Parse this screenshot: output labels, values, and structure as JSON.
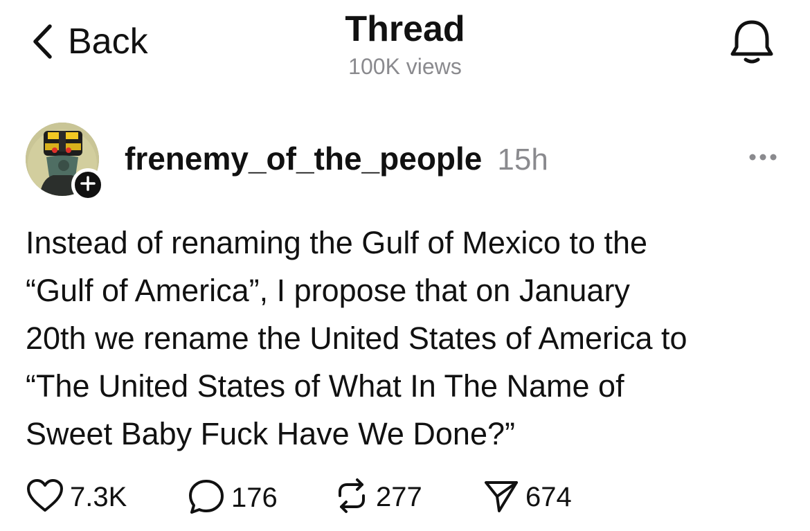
{
  "header": {
    "back_label": "Back",
    "title": "Thread",
    "views": "100K views"
  },
  "post": {
    "username": "frenemy_of_the_people",
    "time": "15h",
    "text": "Instead of renaming the Gulf of Mexico to the\n“Gulf of America”, I propose that on January\n20th we rename the United States of America to\n“The United States of What In The Name of\nSweet Baby Fuck Have We Done?”",
    "actions": {
      "likes": "7.3K",
      "replies": "176",
      "reposts": "277",
      "shares": "674"
    }
  },
  "icons": {
    "back": "chevron-left-icon",
    "notifications": "bell-icon",
    "follow": "plus-icon",
    "more": "more-horizontal-icon",
    "like": "heart-icon",
    "reply": "comment-icon",
    "repost": "repost-icon",
    "share": "send-icon"
  }
}
